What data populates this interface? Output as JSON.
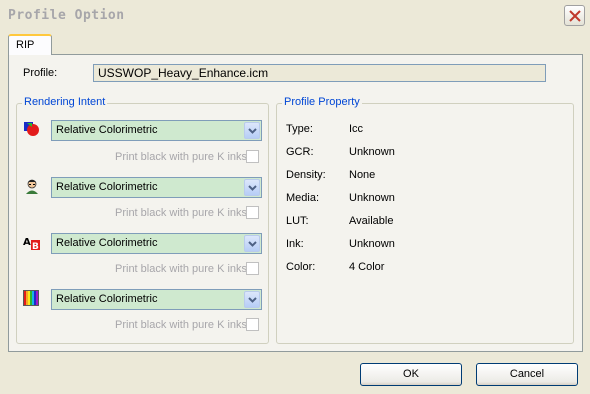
{
  "window": {
    "title": "Profile Option"
  },
  "tabs": [
    {
      "label": "RIP"
    }
  ],
  "profile": {
    "label": "Profile:",
    "value": "USSWOP_Heavy_Enhance.icm"
  },
  "rendering_intent": {
    "title": "Rendering Intent",
    "rows": [
      {
        "icon": "color-circles-icon",
        "intent": "Relative Colorimetric",
        "checkbox_label": "Print black with pure K inks",
        "checked": false
      },
      {
        "icon": "portrait-icon",
        "intent": "Relative Colorimetric",
        "checkbox_label": "Print black with pure K inks",
        "checked": false
      },
      {
        "icon": "text-ab-icon",
        "intent": "Relative Colorimetric",
        "checkbox_label": "Print black with pure K inks",
        "checked": false
      },
      {
        "icon": "color-bars-icon",
        "intent": "Relative Colorimetric",
        "checkbox_label": "Print black with pure K inks",
        "checked": false
      }
    ]
  },
  "profile_property": {
    "title": "Profile Property",
    "items": [
      {
        "key": "Type:",
        "value": "Icc"
      },
      {
        "key": "GCR:",
        "value": "Unknown"
      },
      {
        "key": "Density:",
        "value": "None"
      },
      {
        "key": "Media:",
        "value": "Unknown"
      },
      {
        "key": "LUT:",
        "value": "Available"
      },
      {
        "key": "Ink:",
        "value": "Unknown"
      },
      {
        "key": "Color:",
        "value": "4 Color"
      }
    ]
  },
  "buttons": {
    "ok": "OK",
    "cancel": "Cancel"
  }
}
